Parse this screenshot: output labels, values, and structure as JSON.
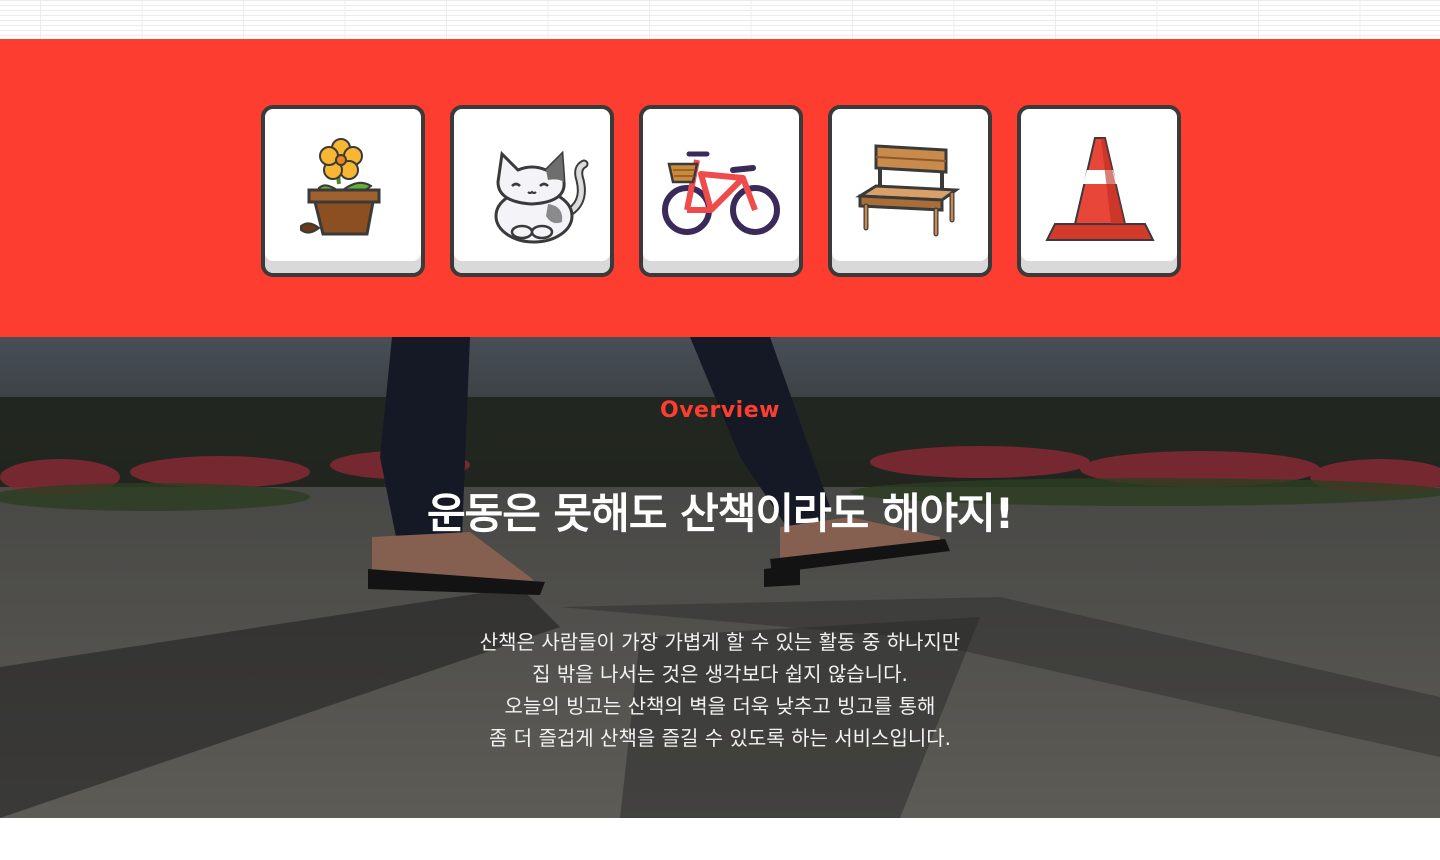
{
  "icon_tiles": [
    {
      "icon": "flower-pot-icon"
    },
    {
      "icon": "cat-icon"
    },
    {
      "icon": "bicycle-icon"
    },
    {
      "icon": "bench-icon"
    },
    {
      "icon": "traffic-cone-icon"
    }
  ],
  "overview": {
    "label": "Overview",
    "headline": "운동은 못해도 산책이라도 해야지!",
    "description": [
      "산책은 사람들이 가장 가볍게 할 수 있는 활동 중 하나지만",
      "집 밖을 나서는 것은 생각보다 쉽지 않습니다.",
      "오늘의 빙고는 산책의 벽을 더욱 낮추고 빙고를 통해",
      "좀 더 즐겁게 산책을 즐길 수 있도록 하는 서비스입니다."
    ]
  },
  "colors": {
    "accent_red": "#fc3d2f",
    "tile_border": "#3a3a3a",
    "text_white": "#ffffff"
  }
}
